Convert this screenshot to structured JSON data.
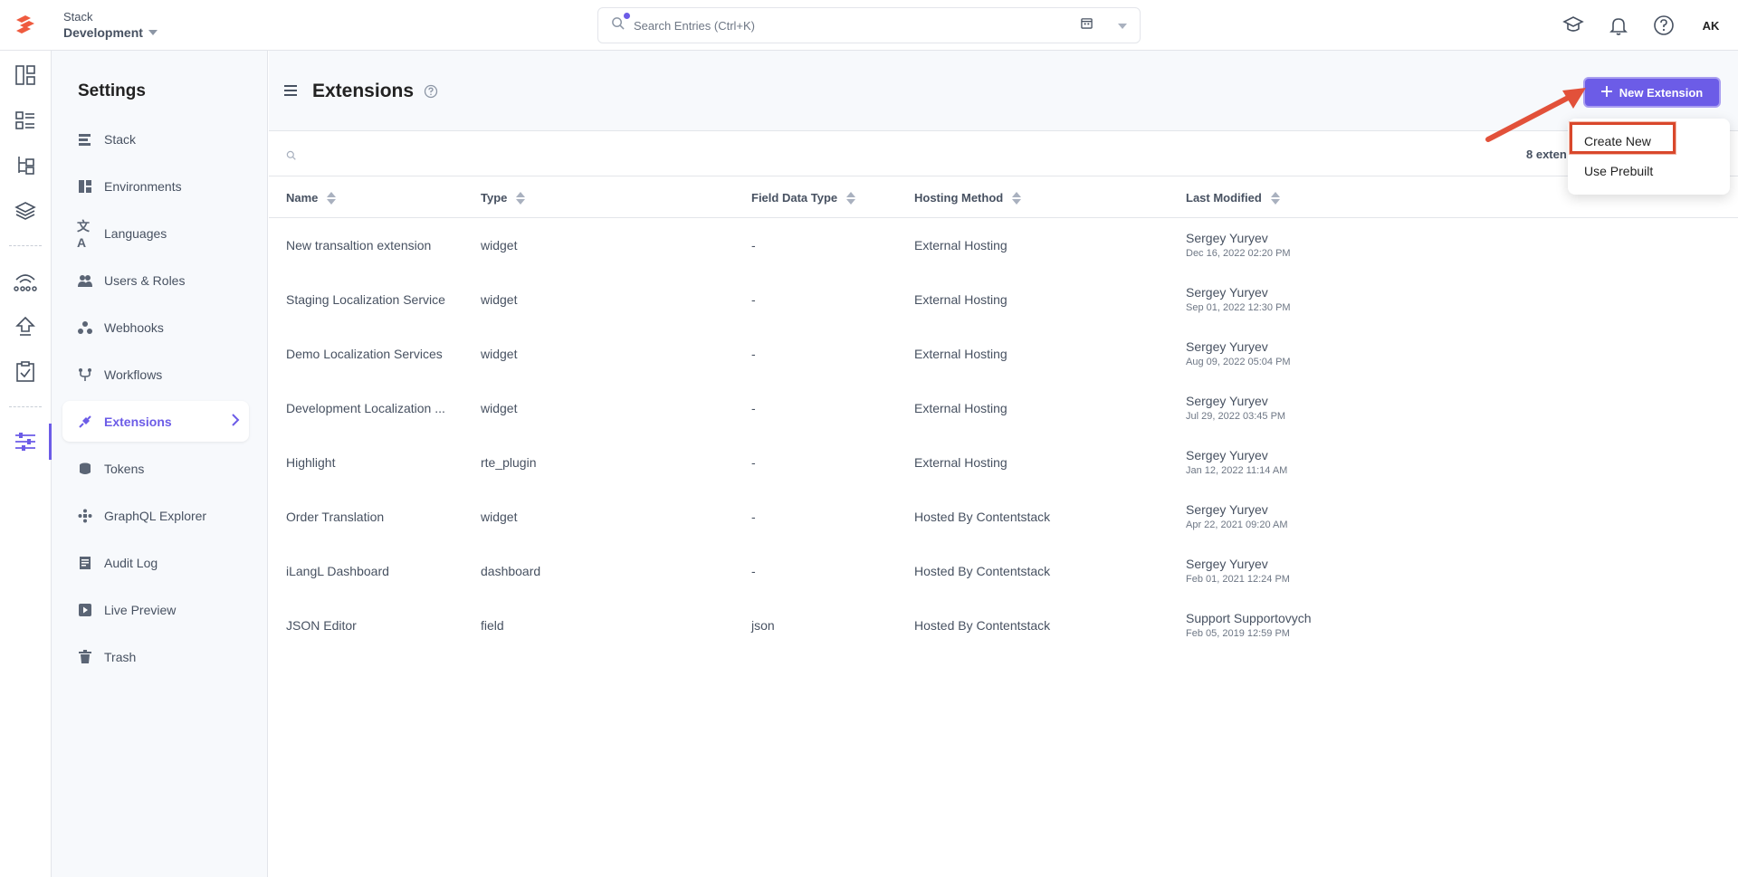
{
  "topbar": {
    "stack_label": "Stack",
    "stack_name": "Development",
    "search_placeholder": "Search Entries (Ctrl+K)",
    "avatar_initials": "AK"
  },
  "rail_icons": [
    "dashboard-icon",
    "content-models-icon",
    "entries-icon",
    "assets-icon",
    "releases-icon",
    "deploy-icon",
    "tasks-icon",
    "settings-icon"
  ],
  "settings": {
    "title": "Settings",
    "items": [
      {
        "label": "Stack",
        "icon": "stack-icon"
      },
      {
        "label": "Environments",
        "icon": "environments-icon"
      },
      {
        "label": "Languages",
        "icon": "languages-icon"
      },
      {
        "label": "Users & Roles",
        "icon": "users-icon"
      },
      {
        "label": "Webhooks",
        "icon": "webhooks-icon"
      },
      {
        "label": "Workflows",
        "icon": "workflows-icon"
      },
      {
        "label": "Extensions",
        "icon": "extensions-icon",
        "active": true
      },
      {
        "label": "Tokens",
        "icon": "tokens-icon"
      },
      {
        "label": "GraphQL Explorer",
        "icon": "graphql-icon"
      },
      {
        "label": "Audit Log",
        "icon": "audit-log-icon"
      },
      {
        "label": "Live Preview",
        "icon": "live-preview-icon"
      },
      {
        "label": "Trash",
        "icon": "trash-icon"
      }
    ]
  },
  "main": {
    "title": "Extensions",
    "new_button_label": "New Extension",
    "count_text": "8 exten",
    "columns": [
      "Name",
      "Type",
      "Field Data Type",
      "Hosting Method",
      "Last Modified"
    ],
    "rows": [
      {
        "name": "New transaltion extension",
        "type": "widget",
        "field_data_type": "-",
        "hosting": "External Hosting",
        "modified_by": "Sergey Yuryev",
        "modified_at": "Dec 16, 2022 02:20 PM"
      },
      {
        "name": "Staging Localization Service",
        "type": "widget",
        "field_data_type": "-",
        "hosting": "External Hosting",
        "modified_by": "Sergey Yuryev",
        "modified_at": "Sep 01, 2022 12:30 PM"
      },
      {
        "name": "Demo Localization Services",
        "type": "widget",
        "field_data_type": "-",
        "hosting": "External Hosting",
        "modified_by": "Sergey Yuryev",
        "modified_at": "Aug 09, 2022 05:04 PM"
      },
      {
        "name": "Development Localization ...",
        "type": "widget",
        "field_data_type": "-",
        "hosting": "External Hosting",
        "modified_by": "Sergey Yuryev",
        "modified_at": "Jul 29, 2022 03:45 PM"
      },
      {
        "name": "Highlight",
        "type": "rte_plugin",
        "field_data_type": "-",
        "hosting": "External Hosting",
        "modified_by": "Sergey Yuryev",
        "modified_at": "Jan 12, 2022 11:14 AM"
      },
      {
        "name": "Order Translation",
        "type": "widget",
        "field_data_type": "-",
        "hosting": "Hosted By Contentstack",
        "modified_by": "Sergey Yuryev",
        "modified_at": "Apr 22, 2021 09:20 AM"
      },
      {
        "name": "iLangL Dashboard",
        "type": "dashboard",
        "field_data_type": "-",
        "hosting": "Hosted By Contentstack",
        "modified_by": "Sergey Yuryev",
        "modified_at": "Feb 01, 2021 12:24 PM"
      },
      {
        "name": "JSON Editor",
        "type": "field",
        "field_data_type": "json",
        "hosting": "Hosted By Contentstack",
        "modified_by": "Support Supportovych",
        "modified_at": "Feb 05, 2019 12:59 PM"
      }
    ]
  },
  "dropdown": {
    "items": [
      "Create New",
      "Use Prebuilt"
    ]
  },
  "colors": {
    "accent": "#6c5ce7",
    "highlight": "#d9472b",
    "text": "#475161"
  }
}
